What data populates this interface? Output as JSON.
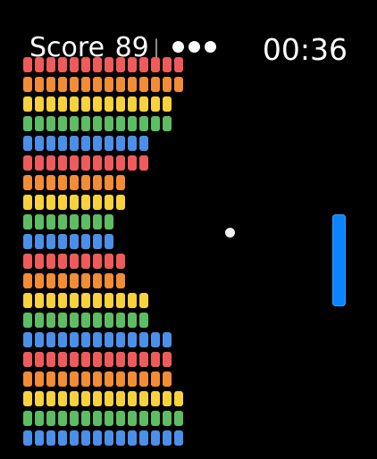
{
  "hud": {
    "score_label": "Score",
    "score_value": "89",
    "lives_remaining": 3,
    "timer": "00:36"
  },
  "colors": {
    "red": "#ef5b5b",
    "orange": "#f28c35",
    "yellow": "#f7d23c",
    "green": "#5dbd63",
    "blue": "#4a90e8",
    "paddle": "#0a84ff",
    "ball": "#f2f2f2"
  },
  "bricks": {
    "rows": [
      {
        "color": "red",
        "count": 14
      },
      {
        "color": "orange",
        "count": 14
      },
      {
        "color": "yellow",
        "count": 13
      },
      {
        "color": "green",
        "count": 13
      },
      {
        "color": "blue",
        "count": 11
      },
      {
        "color": "red",
        "count": 11
      },
      {
        "color": "orange",
        "count": 9
      },
      {
        "color": "yellow",
        "count": 9
      },
      {
        "color": "green",
        "count": 8
      },
      {
        "color": "blue",
        "count": 8
      },
      {
        "color": "red",
        "count": 9
      },
      {
        "color": "orange",
        "count": 9
      },
      {
        "color": "yellow",
        "count": 11
      },
      {
        "color": "green",
        "count": 11
      },
      {
        "color": "blue",
        "count": 13
      },
      {
        "color": "red",
        "count": 13
      },
      {
        "color": "orange",
        "count": 13
      },
      {
        "color": "yellow",
        "count": 14
      },
      {
        "color": "green",
        "count": 14
      },
      {
        "color": "blue",
        "count": 14
      }
    ]
  }
}
